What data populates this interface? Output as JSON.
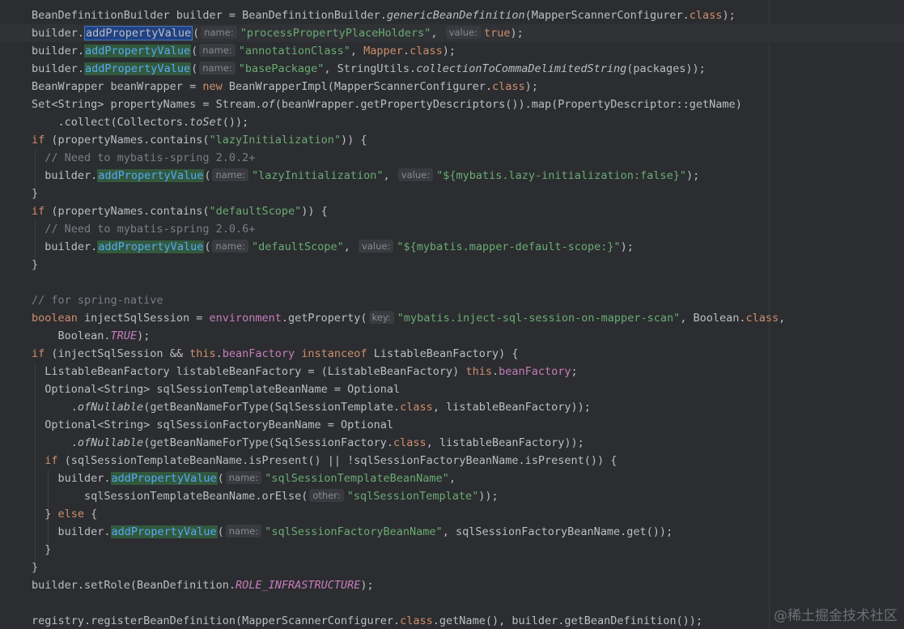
{
  "editor": {
    "lines": [
      [
        {
          "t": "BeanDefinitionBuilder builder = BeanDefinitionBuilder."
        },
        {
          "t": "genericBeanDefinition",
          "c": "it"
        },
        {
          "t": "(MapperScannerConfigurer."
        },
        {
          "t": "class",
          "c": "kw"
        },
        {
          "t": ");"
        }
      ],
      [
        {
          "t": "builder."
        },
        {
          "t": "addPropertyValue",
          "c": "hl-sel"
        },
        {
          "t": "("
        },
        {
          "h": "name:"
        },
        {
          "t": "\"processPropertyPlaceHolders\"",
          "c": "str"
        },
        {
          "t": ", "
        },
        {
          "h": "value:"
        },
        {
          "t": "true",
          "c": "kw"
        },
        {
          "t": ");"
        }
      ],
      [
        {
          "t": "builder."
        },
        {
          "t": "addPropertyValue",
          "c": "hl-green"
        },
        {
          "t": "("
        },
        {
          "h": "name:"
        },
        {
          "t": "\"annotationClass\"",
          "c": "str"
        },
        {
          "t": ", "
        },
        {
          "t": "Mapper",
          "c": "kw"
        },
        {
          "t": "."
        },
        {
          "t": "class",
          "c": "kw"
        },
        {
          "t": ");"
        }
      ],
      [
        {
          "t": "builder."
        },
        {
          "t": "addPropertyValue",
          "c": "hl-green"
        },
        {
          "t": "("
        },
        {
          "h": "name:"
        },
        {
          "t": "\"basePackage\"",
          "c": "str"
        },
        {
          "t": ", StringUtils."
        },
        {
          "t": "collectionToCommaDelimitedString",
          "c": "it"
        },
        {
          "t": "(packages));"
        }
      ],
      [
        {
          "t": "BeanWrapper beanWrapper = "
        },
        {
          "t": "new",
          "c": "kw"
        },
        {
          "t": " BeanWrapperImpl(MapperScannerConfigurer."
        },
        {
          "t": "class",
          "c": "kw"
        },
        {
          "t": ");"
        }
      ],
      [
        {
          "t": "Set<String> propertyNames = Stream."
        },
        {
          "t": "of",
          "c": "it"
        },
        {
          "t": "(beanWrapper.getPropertyDescriptors()).map(PropertyDescriptor::getName)"
        }
      ],
      [
        {
          "t": "    .collect(Collectors."
        },
        {
          "t": "toSet",
          "c": "it"
        },
        {
          "t": "());"
        }
      ],
      [
        {
          "t": "if",
          "c": "kw"
        },
        {
          "t": " (propertyNames.contains("
        },
        {
          "t": "\"lazyInitialization\"",
          "c": "str"
        },
        {
          "t": ")) {"
        }
      ],
      [
        {
          "t": "  "
        },
        {
          "t": "// Need to mybatis-spring 2.0.2+",
          "c": "cmt"
        }
      ],
      [
        {
          "t": "  builder."
        },
        {
          "t": "addPropertyValue",
          "c": "hl-green"
        },
        {
          "t": "("
        },
        {
          "h": "name:"
        },
        {
          "t": "\"lazyInitialization\"",
          "c": "str"
        },
        {
          "t": ", "
        },
        {
          "h": "value:"
        },
        {
          "t": "\"${mybatis.lazy-initialization:false}\"",
          "c": "str"
        },
        {
          "t": ");"
        }
      ],
      [
        {
          "t": "}"
        }
      ],
      [
        {
          "t": "if",
          "c": "kw"
        },
        {
          "t": " (propertyNames.contains("
        },
        {
          "t": "\"defaultScope\"",
          "c": "str"
        },
        {
          "t": ")) {"
        }
      ],
      [
        {
          "t": "  "
        },
        {
          "t": "// Need to mybatis-spring 2.0.6+",
          "c": "cmt"
        }
      ],
      [
        {
          "t": "  builder."
        },
        {
          "t": "addPropertyValue",
          "c": "hl-green"
        },
        {
          "t": "("
        },
        {
          "h": "name:"
        },
        {
          "t": "\"defaultScope\"",
          "c": "str"
        },
        {
          "t": ", "
        },
        {
          "h": "value:"
        },
        {
          "t": "\"${mybatis.mapper-default-scope:}\"",
          "c": "str"
        },
        {
          "t": ");"
        }
      ],
      [
        {
          "t": "}"
        }
      ],
      [],
      [
        {
          "t": "// for spring-native",
          "c": "cmt"
        }
      ],
      [
        {
          "t": "boolean",
          "c": "kw"
        },
        {
          "t": " injectSqlSession = "
        },
        {
          "t": "environment",
          "c": "fld"
        },
        {
          "t": ".getProperty("
        },
        {
          "h": "key:"
        },
        {
          "t": "\"mybatis.inject-sql-session-on-mapper-scan\"",
          "c": "str"
        },
        {
          "t": ", Boolean."
        },
        {
          "t": "class",
          "c": "kw"
        },
        {
          "t": ","
        }
      ],
      [
        {
          "t": "    Boolean."
        },
        {
          "t": "TRUE",
          "c": "fld it"
        },
        {
          "t": ");"
        }
      ],
      [
        {
          "t": "if",
          "c": "kw"
        },
        {
          "t": " (injectSqlSession && "
        },
        {
          "t": "this",
          "c": "kw"
        },
        {
          "t": "."
        },
        {
          "t": "beanFactory",
          "c": "fld"
        },
        {
          "t": " "
        },
        {
          "t": "instanceof",
          "c": "kw"
        },
        {
          "t": " ListableBeanFactory) {"
        }
      ],
      [
        {
          "t": "  ListableBeanFactory listableBeanFactory = (ListableBeanFactory) "
        },
        {
          "t": "this",
          "c": "kw"
        },
        {
          "t": "."
        },
        {
          "t": "beanFactory",
          "c": "fld"
        },
        {
          "t": ";"
        }
      ],
      [
        {
          "t": "  Optional<String> sqlSessionTemplateBeanName = Optional"
        }
      ],
      [
        {
          "t": "      ."
        },
        {
          "t": "ofNullable",
          "c": "it"
        },
        {
          "t": "(getBeanNameForType(SqlSessionTemplate."
        },
        {
          "t": "class",
          "c": "kw"
        },
        {
          "t": ", listableBeanFactory));"
        }
      ],
      [
        {
          "t": "  Optional<String> sqlSessionFactoryBeanName = Optional"
        }
      ],
      [
        {
          "t": "      ."
        },
        {
          "t": "ofNullable",
          "c": "it"
        },
        {
          "t": "(getBeanNameForType(SqlSessionFactory."
        },
        {
          "t": "class",
          "c": "kw"
        },
        {
          "t": ", listableBeanFactory));"
        }
      ],
      [
        {
          "t": "  "
        },
        {
          "t": "if",
          "c": "kw"
        },
        {
          "t": " (sqlSessionTemplateBeanName.isPresent() || !sqlSessionFactoryBeanName.isPresent()) {"
        }
      ],
      [
        {
          "t": "    builder."
        },
        {
          "t": "addPropertyValue",
          "c": "hl-green"
        },
        {
          "t": "("
        },
        {
          "h": "name:"
        },
        {
          "t": "\"sqlSessionTemplateBeanName\"",
          "c": "str"
        },
        {
          "t": ","
        }
      ],
      [
        {
          "t": "        sqlSessionTemplateBeanName.orElse("
        },
        {
          "h": "other:"
        },
        {
          "t": "\"sqlSessionTemplate\"",
          "c": "str"
        },
        {
          "t": "));"
        }
      ],
      [
        {
          "t": "  } "
        },
        {
          "t": "else",
          "c": "kw"
        },
        {
          "t": " {"
        }
      ],
      [
        {
          "t": "    builder."
        },
        {
          "t": "addPropertyValue",
          "c": "hl-green"
        },
        {
          "t": "("
        },
        {
          "h": "name:"
        },
        {
          "t": "\"sqlSessionFactoryBeanName\"",
          "c": "str"
        },
        {
          "t": ", sqlSessionFactoryBeanName.get());"
        }
      ],
      [
        {
          "t": "  }"
        }
      ],
      [
        {
          "t": "}"
        }
      ],
      [
        {
          "t": "builder.setRole(BeanDefinition."
        },
        {
          "t": "ROLE_INFRASTRUCTURE",
          "c": "fld it"
        },
        {
          "t": ");"
        }
      ],
      [],
      [
        {
          "t": "registry.registerBeanDefinition(MapperScannerConfigurer."
        },
        {
          "t": "class",
          "c": "kw"
        },
        {
          "t": ".getName(), builder.getBeanDefinition());"
        }
      ]
    ]
  },
  "watermark": "@稀土掘金技术社区"
}
